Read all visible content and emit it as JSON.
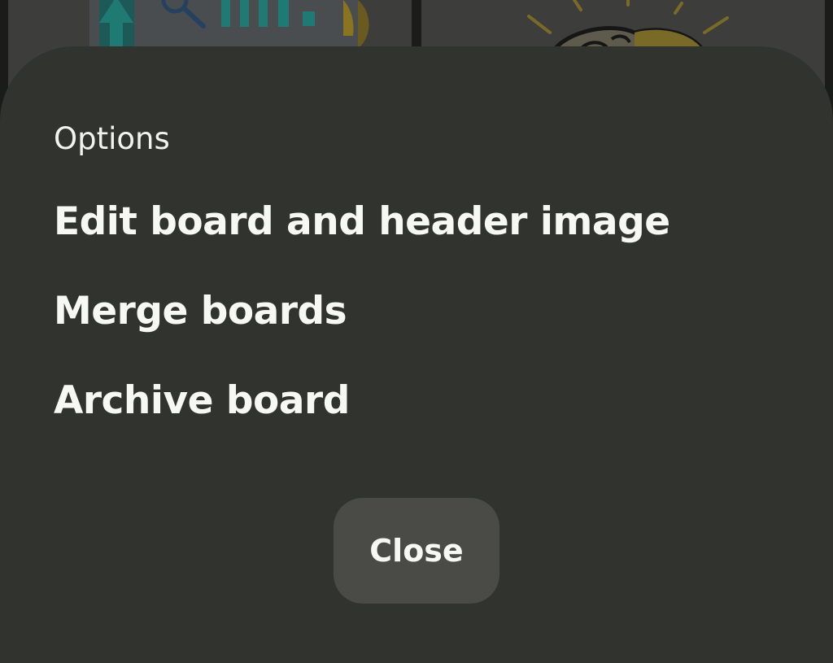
{
  "background_pins": [
    {
      "name": "analytics-illustration",
      "palette": [
        "#1f8f8c",
        "#f1c232",
        "#2f4f7f"
      ]
    },
    {
      "name": "idea-illustration",
      "palette": [
        "#f1c232",
        "#2f2f2f"
      ]
    }
  ],
  "sheet": {
    "title": "Options",
    "items": [
      {
        "label": "Edit board and header image"
      },
      {
        "label": "Merge boards"
      },
      {
        "label": "Archive board"
      }
    ],
    "close_label": "Close"
  },
  "colors": {
    "sheet_bg": "#31332f",
    "button_bg": "#4a4b47",
    "text": "#f7f7f3"
  }
}
